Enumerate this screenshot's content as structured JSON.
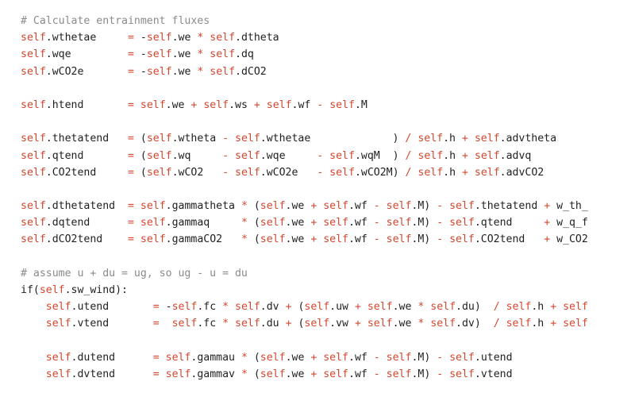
{
  "editor": {
    "language": "python",
    "colors": {
      "background": "#ffffff",
      "text": "#1f1f1f",
      "self_keyword": "#d3472f",
      "operator": "#d3472f",
      "comment": "#8a8a8a"
    },
    "lines": [
      "# Calculate entrainment fluxes",
      "self.wthetae     = -self.we * self.dtheta",
      "self.wqe         = -self.we * self.dq",
      "self.wCO2e       = -self.we * self.dCO2",
      "",
      "self.htend       = self.we + self.ws + self.wf - self.M",
      "",
      "self.thetatend   = (self.wtheta - self.wthetae             ) / self.h + self.advtheta",
      "self.qtend       = (self.wq     - self.wqe     - self.wqM  ) / self.h + self.advq",
      "self.CO2tend     = (self.wCO2   - self.wCO2e   - self.wCO2M) / self.h + self.advCO2",
      "",
      "self.dthetatend  = self.gammatheta * (self.we + self.wf - self.M) - self.thetatend + w_th_",
      "self.dqtend      = self.gammaq     * (self.we + self.wf - self.M) - self.qtend     + w_q_f",
      "self.dCO2tend    = self.gammaCO2   * (self.we + self.wf - self.M) - self.CO2tend   + w_CO2",
      "",
      "# assume u + du = ug, so ug - u = du",
      "if(self.sw_wind):",
      "    self.utend       = -self.fc * self.dv + (self.uw + self.we * self.du)  / self.h + self",
      "    self.vtend       =  self.fc * self.du + (self.vw + self.we * self.dv)  / self.h + self",
      "",
      "    self.dutend      = self.gammau * (self.we + self.wf - self.M) - self.utend",
      "    self.dvtend      = self.gammav * (self.we + self.wf - self.M) - self.vtend"
    ]
  }
}
